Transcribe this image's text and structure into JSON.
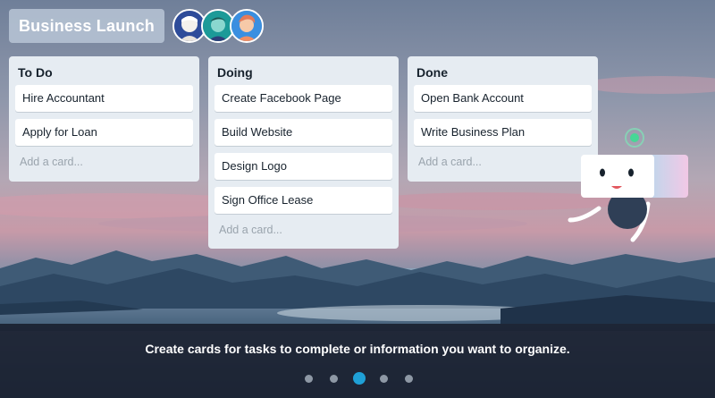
{
  "board": {
    "title": "Business Launch",
    "members": [
      "avatar-1",
      "avatar-2",
      "avatar-3"
    ]
  },
  "lists": [
    {
      "title": "To Do",
      "cards": [
        "Hire Accountant",
        "Apply for Loan"
      ],
      "add_card": "Add a card..."
    },
    {
      "title": "Doing",
      "cards": [
        "Create Facebook Page",
        "Build Website",
        "Design Logo",
        "Sign Office Lease"
      ],
      "add_card": "Add a card..."
    },
    {
      "title": "Done",
      "cards": [
        "Open Bank Account",
        "Write Business Plan"
      ],
      "add_card": "Add a card..."
    }
  ],
  "caption": "Create cards for tasks to complete or information you want to organize.",
  "carousel": {
    "total": 5,
    "active_index": 2
  },
  "colors": {
    "list_bg": "#e6ecf2",
    "active_dot": "#1fa0d6",
    "inactive_dot": "#8e98a5",
    "caption_bar": "#181e2c"
  },
  "icons": [
    "robot-mascot-icon",
    "signal-antenna-icon"
  ]
}
